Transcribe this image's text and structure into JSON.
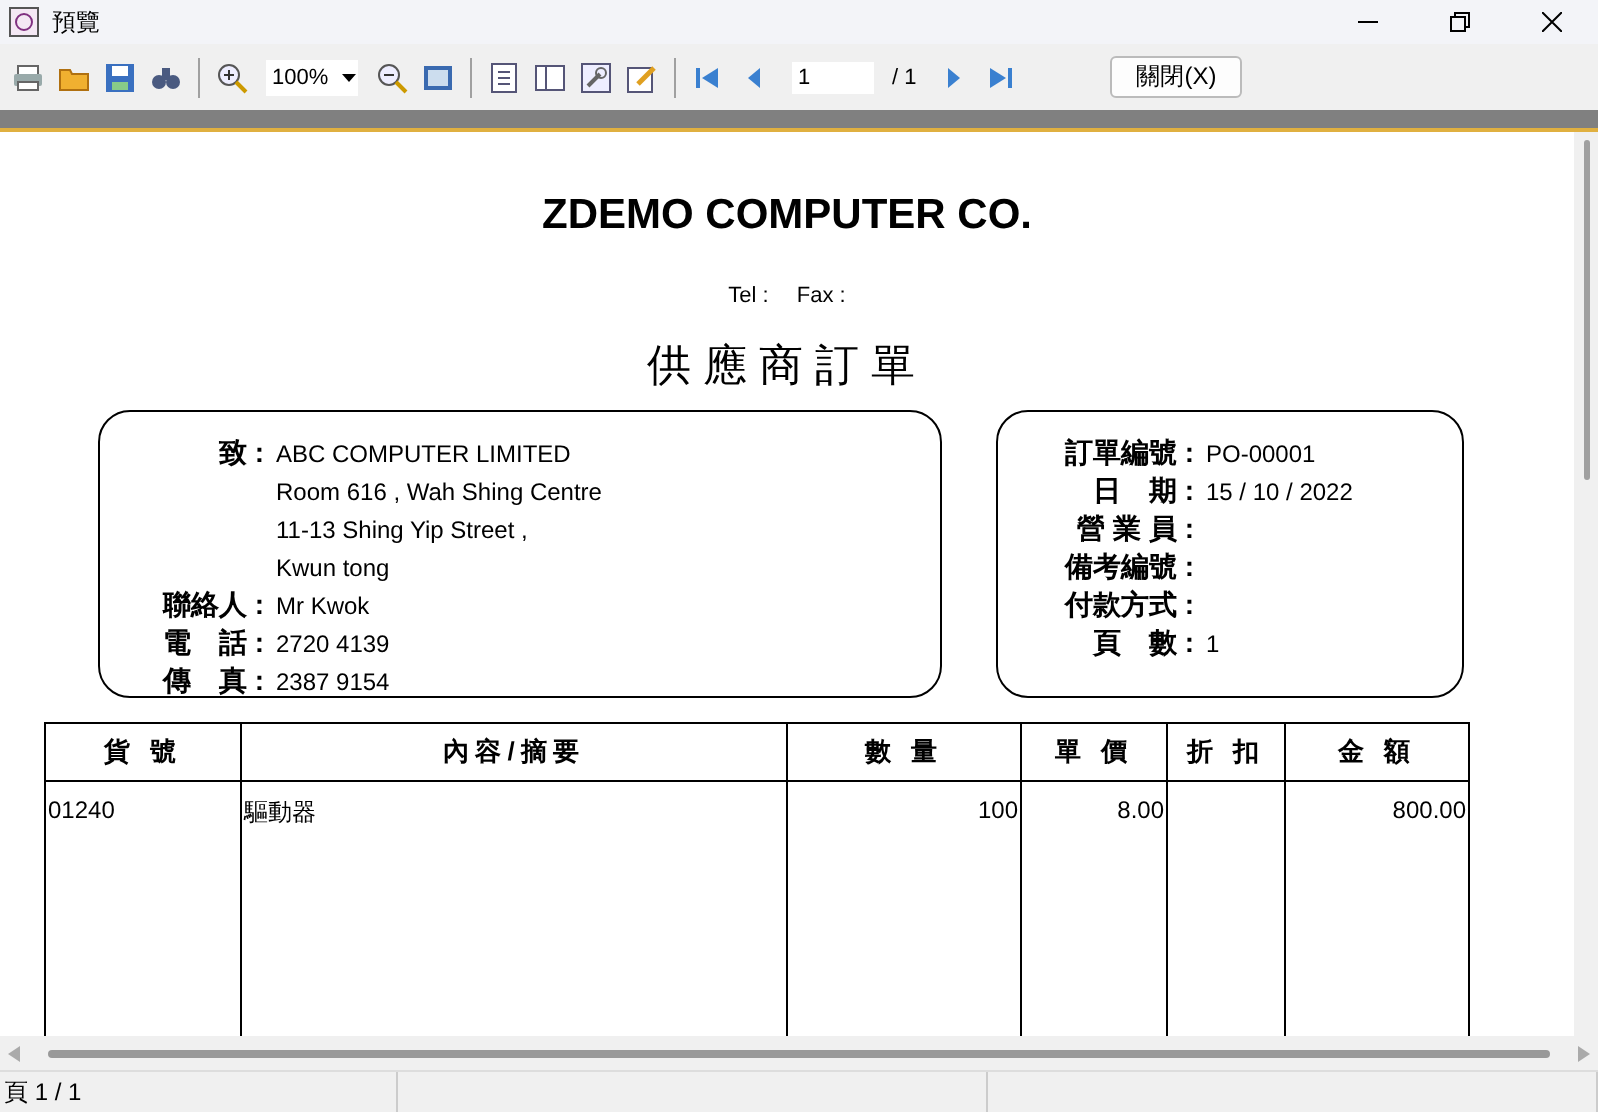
{
  "window": {
    "title": "預覽"
  },
  "toolbar": {
    "zoom": "100%",
    "page": "1",
    "page_total": "/ 1",
    "close_button": "關閉(X)"
  },
  "report": {
    "company": "ZDEMO COMPUTER CO.",
    "contact_line": [
      {
        "label": "Tel :"
      },
      {
        "label": "Fax :"
      }
    ],
    "title": "供應商訂單",
    "supplier": [
      {
        "label": "致 :",
        "value": "ABC COMPUTER LIMITED"
      },
      {
        "value": "Room 616 , Wah Shing Centre"
      },
      {
        "value": "11-13 Shing Yip Street ,"
      },
      {
        "value": "Kwun tong"
      },
      {
        "label": "聯絡人 :",
        "value": "Mr Kwok"
      },
      {
        "label": "電　話 :",
        "value": "2720 4139"
      },
      {
        "label": "傳　真 :",
        "value": "2387 9154"
      }
    ],
    "order": [
      {
        "label": "訂單編號 :",
        "value": "PO-00001"
      },
      {
        "label": "日　期 :",
        "value": "15 / 10 / 2022"
      },
      {
        "label": "營 業 員 :"
      },
      {
        "label": "備考編號 :"
      },
      {
        "label": "付款方式 :"
      },
      {
        "label": "頁　數 :",
        "value": "1"
      }
    ],
    "table": {
      "columns": [
        "貨 號",
        "內容/摘要",
        "數 量",
        "單 價",
        "折 扣",
        "金 額"
      ],
      "rows": [
        [
          "01240",
          "驅動器",
          "100",
          "8.00",
          "",
          "800.00"
        ]
      ]
    }
  },
  "status_bar": {
    "text": "頁 1 / 1"
  }
}
